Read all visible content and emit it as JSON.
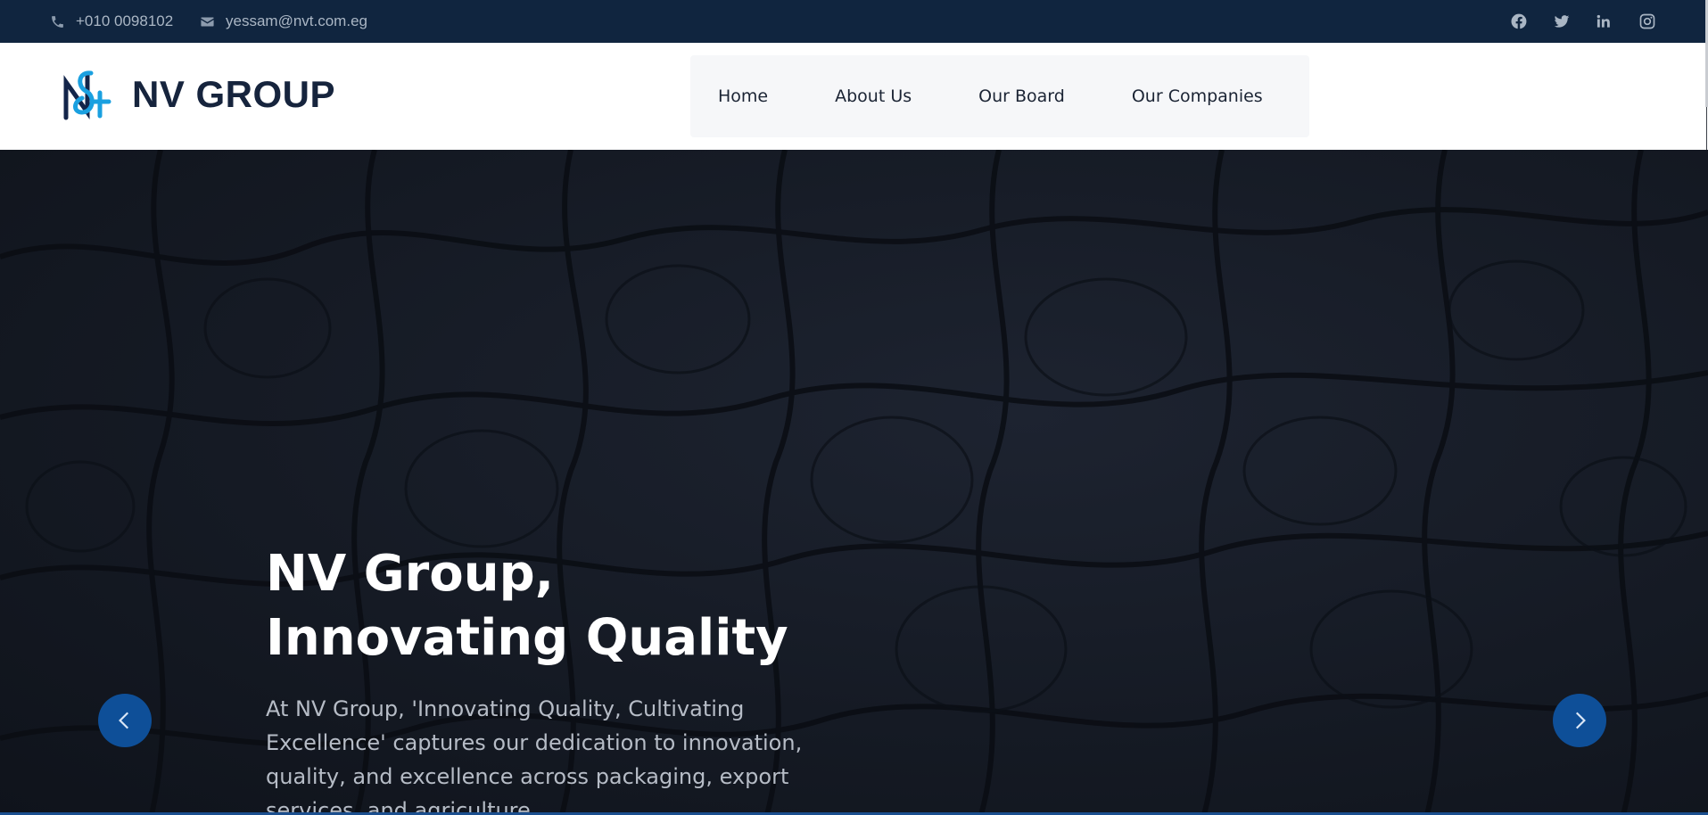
{
  "topbar": {
    "phone": "+010 0098102",
    "email": "yessam@nvt.com.eg",
    "icons": [
      "phone-icon",
      "envelope-icon"
    ],
    "socials": [
      "facebook-icon",
      "twitter-icon",
      "linkedin-icon",
      "instagram-icon"
    ]
  },
  "header": {
    "brand": "NV GROUP",
    "logo": "nv-monogram-logo",
    "nav": [
      "Home",
      "About Us",
      "Our Board",
      "Our Companies"
    ]
  },
  "hero": {
    "title": "NV Group, Innovating Quality",
    "text": "At NV Group, 'Innovating Quality, Cultivating Excellence' captures our dedication to innovation, quality, and excellence across packaging, export services, and agriculture.",
    "controls": [
      "chevron-left-icon",
      "chevron-right-icon"
    ]
  },
  "colors": {
    "topbar_bg": "#10253f",
    "brand_text": "#16243d",
    "accent_blue": "#0e4f98",
    "hero_bg": "#151a24"
  }
}
